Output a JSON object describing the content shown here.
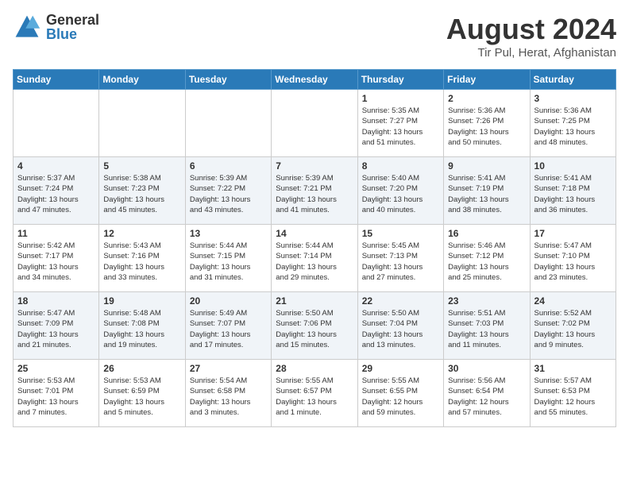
{
  "logo": {
    "general": "General",
    "blue": "Blue"
  },
  "title": "August 2024",
  "location": "Tir Pul, Herat, Afghanistan",
  "days": [
    "Sunday",
    "Monday",
    "Tuesday",
    "Wednesday",
    "Thursday",
    "Friday",
    "Saturday"
  ],
  "weeks": [
    [
      {
        "day": "",
        "info": ""
      },
      {
        "day": "",
        "info": ""
      },
      {
        "day": "",
        "info": ""
      },
      {
        "day": "",
        "info": ""
      },
      {
        "day": "1",
        "info": "Sunrise: 5:35 AM\nSunset: 7:27 PM\nDaylight: 13 hours\nand 51 minutes."
      },
      {
        "day": "2",
        "info": "Sunrise: 5:36 AM\nSunset: 7:26 PM\nDaylight: 13 hours\nand 50 minutes."
      },
      {
        "day": "3",
        "info": "Sunrise: 5:36 AM\nSunset: 7:25 PM\nDaylight: 13 hours\nand 48 minutes."
      }
    ],
    [
      {
        "day": "4",
        "info": "Sunrise: 5:37 AM\nSunset: 7:24 PM\nDaylight: 13 hours\nand 47 minutes."
      },
      {
        "day": "5",
        "info": "Sunrise: 5:38 AM\nSunset: 7:23 PM\nDaylight: 13 hours\nand 45 minutes."
      },
      {
        "day": "6",
        "info": "Sunrise: 5:39 AM\nSunset: 7:22 PM\nDaylight: 13 hours\nand 43 minutes."
      },
      {
        "day": "7",
        "info": "Sunrise: 5:39 AM\nSunset: 7:21 PM\nDaylight: 13 hours\nand 41 minutes."
      },
      {
        "day": "8",
        "info": "Sunrise: 5:40 AM\nSunset: 7:20 PM\nDaylight: 13 hours\nand 40 minutes."
      },
      {
        "day": "9",
        "info": "Sunrise: 5:41 AM\nSunset: 7:19 PM\nDaylight: 13 hours\nand 38 minutes."
      },
      {
        "day": "10",
        "info": "Sunrise: 5:41 AM\nSunset: 7:18 PM\nDaylight: 13 hours\nand 36 minutes."
      }
    ],
    [
      {
        "day": "11",
        "info": "Sunrise: 5:42 AM\nSunset: 7:17 PM\nDaylight: 13 hours\nand 34 minutes."
      },
      {
        "day": "12",
        "info": "Sunrise: 5:43 AM\nSunset: 7:16 PM\nDaylight: 13 hours\nand 33 minutes."
      },
      {
        "day": "13",
        "info": "Sunrise: 5:44 AM\nSunset: 7:15 PM\nDaylight: 13 hours\nand 31 minutes."
      },
      {
        "day": "14",
        "info": "Sunrise: 5:44 AM\nSunset: 7:14 PM\nDaylight: 13 hours\nand 29 minutes."
      },
      {
        "day": "15",
        "info": "Sunrise: 5:45 AM\nSunset: 7:13 PM\nDaylight: 13 hours\nand 27 minutes."
      },
      {
        "day": "16",
        "info": "Sunrise: 5:46 AM\nSunset: 7:12 PM\nDaylight: 13 hours\nand 25 minutes."
      },
      {
        "day": "17",
        "info": "Sunrise: 5:47 AM\nSunset: 7:10 PM\nDaylight: 13 hours\nand 23 minutes."
      }
    ],
    [
      {
        "day": "18",
        "info": "Sunrise: 5:47 AM\nSunset: 7:09 PM\nDaylight: 13 hours\nand 21 minutes."
      },
      {
        "day": "19",
        "info": "Sunrise: 5:48 AM\nSunset: 7:08 PM\nDaylight: 13 hours\nand 19 minutes."
      },
      {
        "day": "20",
        "info": "Sunrise: 5:49 AM\nSunset: 7:07 PM\nDaylight: 13 hours\nand 17 minutes."
      },
      {
        "day": "21",
        "info": "Sunrise: 5:50 AM\nSunset: 7:06 PM\nDaylight: 13 hours\nand 15 minutes."
      },
      {
        "day": "22",
        "info": "Sunrise: 5:50 AM\nSunset: 7:04 PM\nDaylight: 13 hours\nand 13 minutes."
      },
      {
        "day": "23",
        "info": "Sunrise: 5:51 AM\nSunset: 7:03 PM\nDaylight: 13 hours\nand 11 minutes."
      },
      {
        "day": "24",
        "info": "Sunrise: 5:52 AM\nSunset: 7:02 PM\nDaylight: 13 hours\nand 9 minutes."
      }
    ],
    [
      {
        "day": "25",
        "info": "Sunrise: 5:53 AM\nSunset: 7:01 PM\nDaylight: 13 hours\nand 7 minutes."
      },
      {
        "day": "26",
        "info": "Sunrise: 5:53 AM\nSunset: 6:59 PM\nDaylight: 13 hours\nand 5 minutes."
      },
      {
        "day": "27",
        "info": "Sunrise: 5:54 AM\nSunset: 6:58 PM\nDaylight: 13 hours\nand 3 minutes."
      },
      {
        "day": "28",
        "info": "Sunrise: 5:55 AM\nSunset: 6:57 PM\nDaylight: 13 hours\nand 1 minute."
      },
      {
        "day": "29",
        "info": "Sunrise: 5:55 AM\nSunset: 6:55 PM\nDaylight: 12 hours\nand 59 minutes."
      },
      {
        "day": "30",
        "info": "Sunrise: 5:56 AM\nSunset: 6:54 PM\nDaylight: 12 hours\nand 57 minutes."
      },
      {
        "day": "31",
        "info": "Sunrise: 5:57 AM\nSunset: 6:53 PM\nDaylight: 12 hours\nand 55 minutes."
      }
    ]
  ]
}
